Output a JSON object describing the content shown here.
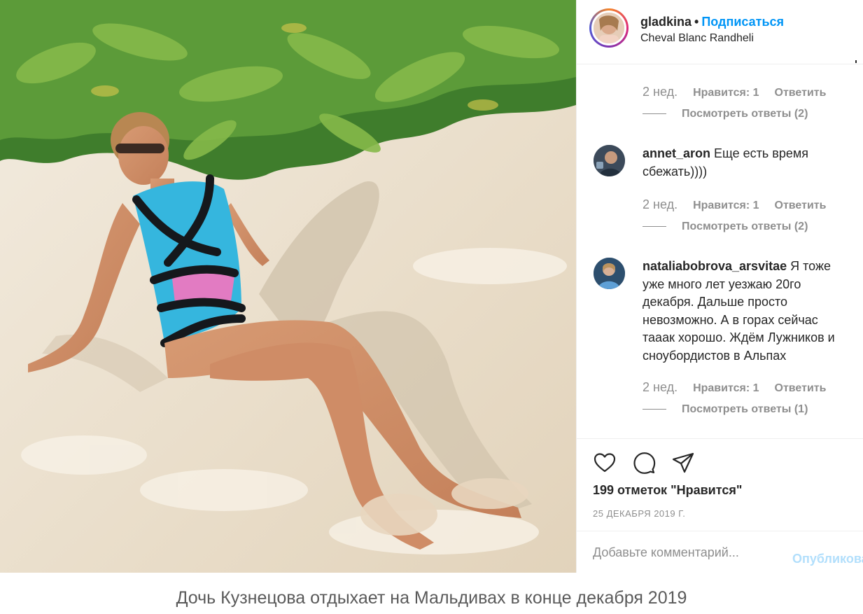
{
  "post": {
    "username": "gladkina",
    "separator": "•",
    "follow_label": "Подписаться",
    "location": "Cheval Blanc Randheli"
  },
  "comments": {
    "top_meta": {
      "time": "2 нед.",
      "likes": "Нравится: 1",
      "reply": "Ответить",
      "view_replies": "Посмотреть ответы (2)"
    },
    "items": [
      {
        "username": "annet_aron",
        "text": "Еще есть время сбежать))))",
        "time": "2 нед.",
        "likes": "Нравится: 1",
        "reply": "Ответить",
        "view_replies": "Посмотреть ответы (2)"
      },
      {
        "username": "nataliabobrova_arsvitae",
        "text": "Я тоже уже много лет уезжаю 20го декабря. Дальше просто невозможно. А в горах сейчас тааак хорошо. Ждём Лужников и сноубордистов в Альпах",
        "time": "2 нед.",
        "likes": "Нравится: 1",
        "reply": "Ответить",
        "view_replies": "Посмотреть ответы (1)"
      }
    ]
  },
  "actions": {
    "icons": [
      "heart-icon",
      "comment-icon",
      "share-icon"
    ],
    "likes_count": "199 отметок \"Нравится\"",
    "date": "25 ДЕКАБРЯ 2019 Г."
  },
  "add_comment": {
    "placeholder": "Добавьте комментарий...",
    "publish_label": "Опубликовать"
  },
  "caption": "Дочь Кузнецова отдыхает на Мальдивах в конце декабря 2019",
  "colors": {
    "link_blue": "#0095f6",
    "publish_disabled": "#b2dffc",
    "muted_text": "#8e8e8e",
    "primary_text": "#262626",
    "border": "#efefef"
  }
}
